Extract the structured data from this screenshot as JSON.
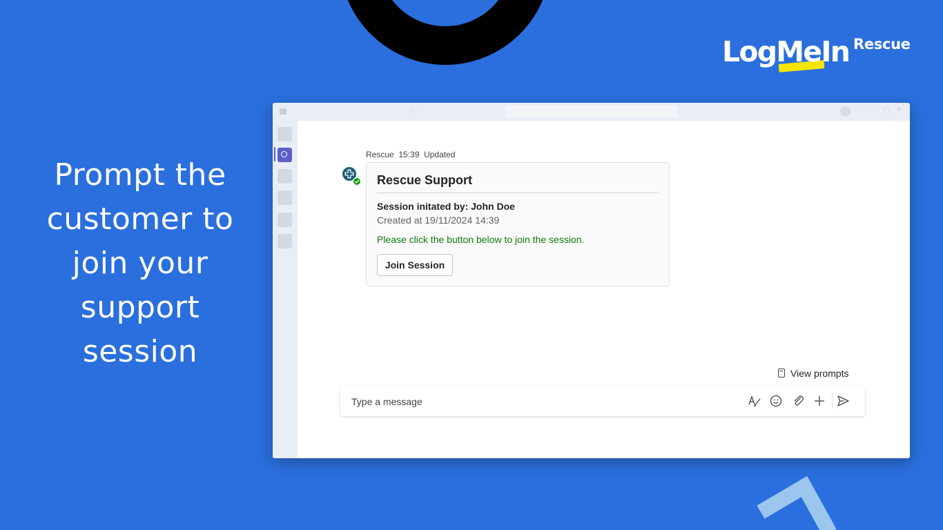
{
  "brand": {
    "logo_text": "LogMeIn",
    "product": "Rescue",
    "accent_yellow": "#f5e500",
    "background_blue": "#2a6fdd"
  },
  "headline": {
    "lines": [
      "Prompt the",
      "customer to",
      "join your",
      "support",
      "session"
    ]
  },
  "window": {
    "rail_items": [
      "rail-item",
      "chat-icon",
      "rail-item",
      "rail-item",
      "rail-item",
      "rail-item"
    ],
    "active_item": "chat-icon",
    "active_color": "#5b5fc7"
  },
  "message": {
    "sender": "Rescue",
    "time": "15:39",
    "status": "Updated",
    "avatar_icon": "medical-cross-icon",
    "card": {
      "title": "Rescue Support",
      "initiator": "Session initated by: John Doe",
      "created": "Created at 19/11/2024 14:39",
      "instruction": "Please click the button below to join the session.",
      "instruction_color": "#0e7a0d",
      "button_label": "Join Session"
    }
  },
  "compose": {
    "view_prompts_label": "View prompts",
    "placeholder": "Type a message",
    "icons": [
      "format-icon",
      "emoji-icon",
      "attach-icon",
      "plus-icon",
      "send-icon"
    ]
  }
}
